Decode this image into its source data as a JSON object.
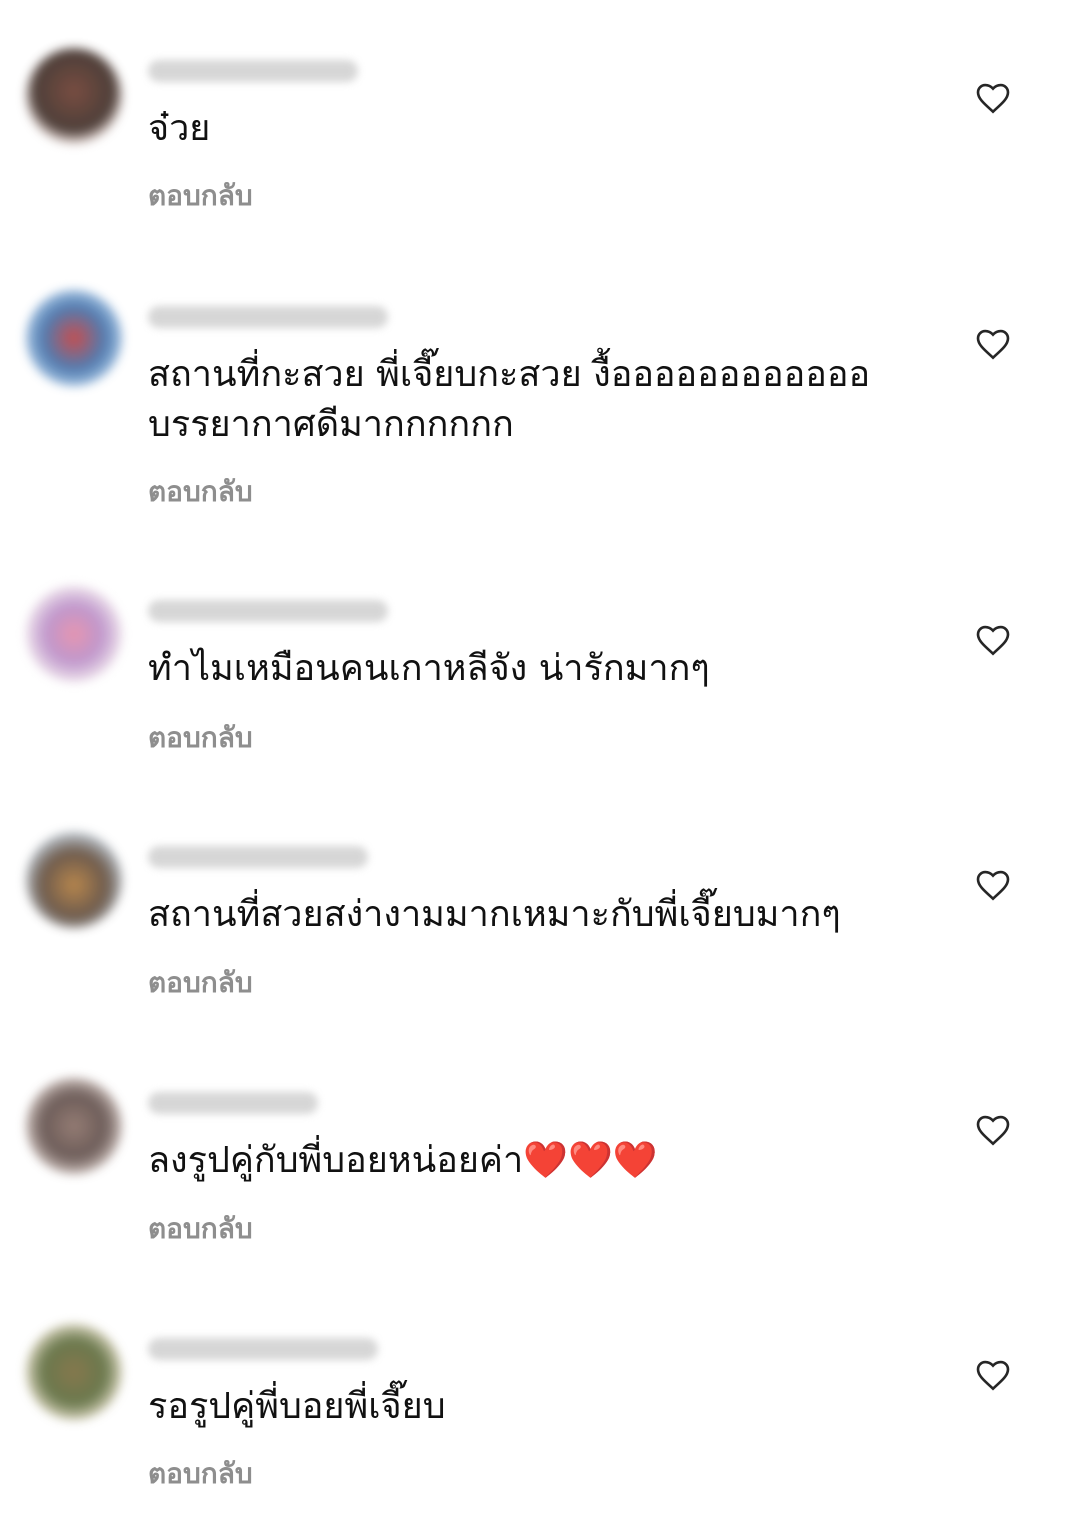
{
  "colors": {
    "text": "#111111",
    "secondary_text": "#8e8e8e",
    "background": "#ffffff"
  },
  "icons": {
    "like": "heart-outline-icon"
  },
  "comments": [
    {
      "text": "จ๋วย",
      "reply_label": "ตอบกลับ"
    },
    {
      "text": "สถานที่กะสวย พี่เจี๊ยบกะสวย งื้ออออออออออออ\nบรรยากาศดีมากกกกกก",
      "reply_label": "ตอบกลับ"
    },
    {
      "text": "ทำไมเหมือนคนเกาหลีจัง น่ารักมากๆ",
      "reply_label": "ตอบกลับ"
    },
    {
      "text": "สถานที่สวยสง่างามมากเหมาะกับพี่เจี๊ยบมากๆ",
      "reply_label": "ตอบกลับ"
    },
    {
      "text": "ลงรูปคู่กับพี่บอยหน่อยค่า❤️❤️❤️",
      "reply_label": "ตอบกลับ"
    },
    {
      "text": "รอรูปคู่พี่บอยพี่เจี๊ยบ",
      "reply_label": "ตอบกลับ"
    }
  ]
}
